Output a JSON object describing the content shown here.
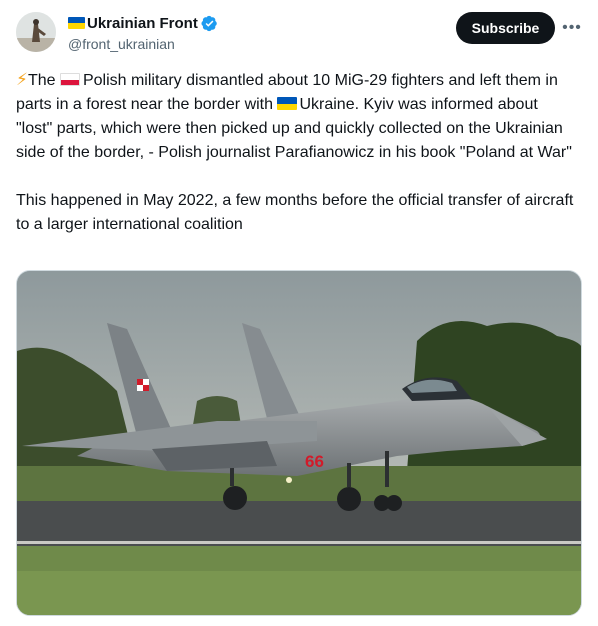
{
  "account": {
    "display_name": "Ukrainian Front",
    "handle": "@front_ukrainian",
    "verified": true,
    "avatar_icon": "avatar-image"
  },
  "actions": {
    "subscribe_label": "Subscribe",
    "more_label": "•••"
  },
  "tweet": {
    "p1_a": "The ",
    "p1_b": "Polish military dismantled about 10 MiG-29 fighters and left them in parts in a forest near the border with ",
    "p1_c": "Ukraine. Kyiv was informed about \"lost\" parts, which were then picked up and quickly collected on the Ukrainian side of the border, - Polish journalist Parafianowicz in his book \"Poland at War\"",
    "p2": "This happened in May 2022, a few months before the official transfer of aircraft to a larger international coalition"
  },
  "media": {
    "description_icon": "fighter-jet-photo",
    "tail_number": "66"
  },
  "colors": {
    "accent": "#1d9bf0",
    "text": "#0f1419",
    "muted": "#536471",
    "button_bg": "#0f1419"
  }
}
